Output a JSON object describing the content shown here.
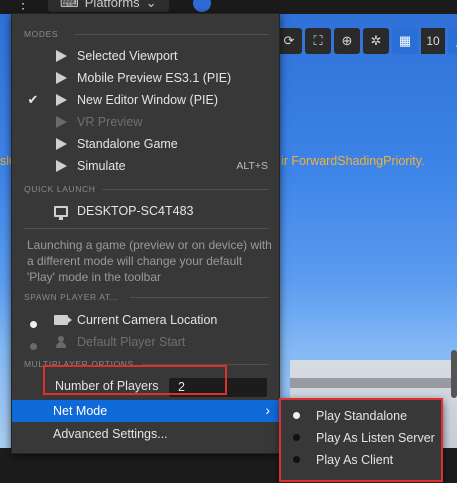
{
  "top": {
    "platforms_label": "Platforms"
  },
  "viewport": {
    "warning_left": "slu",
    "warning_right": "ir ForwardShadingPriority.",
    "camera_speed": "10"
  },
  "menu": {
    "modes_header": "MODES",
    "modes": [
      {
        "label": "Selected Viewport",
        "checked": false,
        "disabled": false,
        "icon": "play-icon"
      },
      {
        "label": "Mobile Preview ES3.1 (PIE)",
        "checked": false,
        "disabled": false,
        "icon": "play-icon"
      },
      {
        "label": "New Editor Window (PIE)",
        "checked": true,
        "disabled": false,
        "icon": "play-icon"
      },
      {
        "label": "VR Preview",
        "checked": false,
        "disabled": true,
        "icon": "play-icon"
      },
      {
        "label": "Standalone Game",
        "checked": false,
        "disabled": false,
        "icon": "play-icon"
      },
      {
        "label": "Simulate",
        "checked": false,
        "disabled": false,
        "icon": "play-icon",
        "shortcut": "ALT+S"
      }
    ],
    "quick_launch_header": "QUICK LAUNCH",
    "quick_launch_item": "DESKTOP-SC4T483",
    "info_text": "Launching a game (preview or on device) with a different mode will change your default 'Play' mode in the toolbar",
    "spawn_header": "SPAWN PLAYER AT...",
    "spawn_items": [
      {
        "label": "Current Camera Location",
        "selected": true,
        "disabled": false
      },
      {
        "label": "Default Player Start",
        "selected": false,
        "disabled": true
      }
    ],
    "multiplayer_header": "MULTIPLAYER OPTIONS",
    "players_label": "Number of Players",
    "players_value": "2",
    "net_mode_label": "Net Mode",
    "advanced_label": "Advanced Settings..."
  },
  "submenu": {
    "items": [
      "Play Standalone",
      "Play As Listen Server",
      "Play As Client"
    ],
    "selected_index": 0
  },
  "colors": {
    "highlight": "#0f6ad8",
    "annotation": "#e0302e",
    "warning": "#f2b233"
  }
}
